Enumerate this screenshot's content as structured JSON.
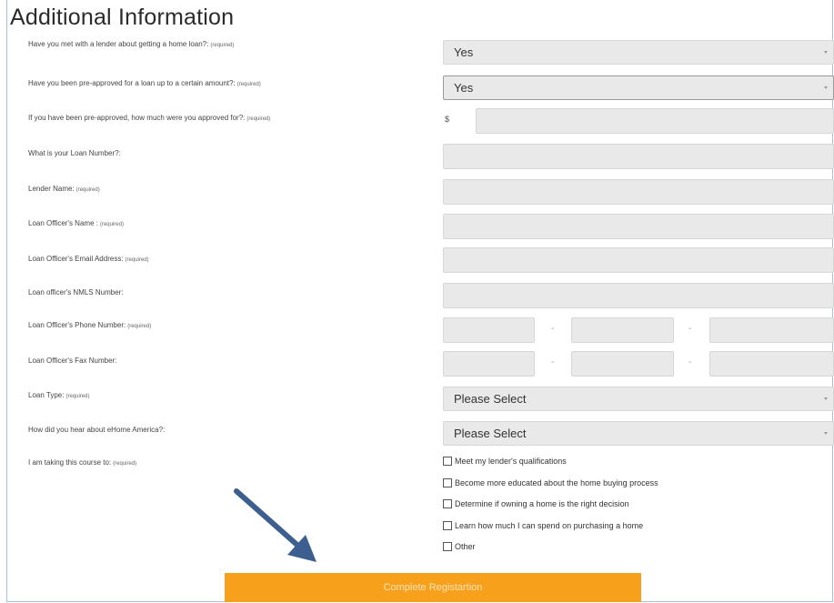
{
  "form": {
    "title": "Additional Information",
    "required_tag": "(required)",
    "questions": {
      "met_lender": {
        "label": "Have you met with a lender about getting a home loan?:",
        "value": "Yes"
      },
      "pre_approved": {
        "label": "Have you been pre-approved for a loan up to a certain amount?:",
        "value": "Yes"
      },
      "approved_amount": {
        "label": "If you have been pre-approved, how much were you approved for?:",
        "prefix": "$",
        "value": ""
      },
      "loan_number": {
        "label": "What is your Loan Number?:",
        "value": ""
      },
      "lender_name": {
        "label": "Lender Name:",
        "value": ""
      },
      "officer_name": {
        "label": "Loan Officer's Name :",
        "value": ""
      },
      "officer_email": {
        "label": "Loan Officer's Email Address:",
        "value": ""
      },
      "officer_nmls": {
        "label": "Loan officer's NMLS Number:",
        "value": ""
      },
      "officer_phone": {
        "label": "Loan Officer's Phone Number:",
        "separator": "-"
      },
      "officer_fax": {
        "label": "Loan Officer's Fax Number:",
        "separator": "-"
      },
      "loan_type": {
        "label": "Loan Type:",
        "value": "Please Select"
      },
      "heard_about": {
        "label": "How did you hear about eHome America?:",
        "value": "Please Select"
      },
      "course_reason": {
        "label": "I am taking this course to:",
        "options": [
          "Meet my lender's qualifications",
          "Become more educated about the home buying process",
          "Determine if owning a home is the right decision",
          "Learn how much I can spend on purchasing a home",
          "Other"
        ]
      }
    },
    "submit_label": "Complete Registartion"
  },
  "colors": {
    "accent": "#f7a01c",
    "arrow": "#3d5f8f",
    "field_bg": "#e9e9e9"
  },
  "icons": [
    "caret-down-icon",
    "arrow-pointer-icon"
  ]
}
